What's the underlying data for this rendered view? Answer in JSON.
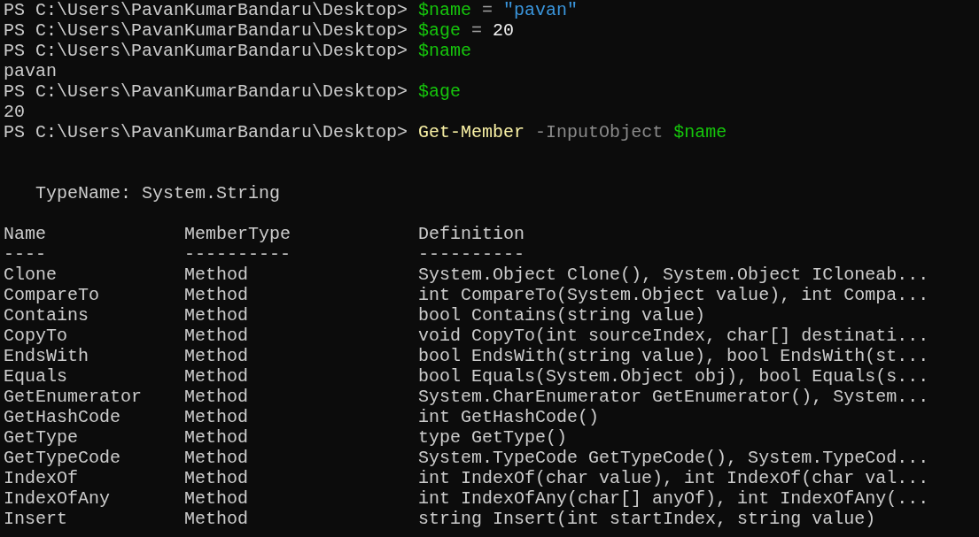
{
  "session": [
    {
      "kind": "command",
      "prompt": "PS C:\\Users\\PavanKumarBandaru\\Desktop>",
      "tokens": [
        {
          "text": "$name",
          "kind": "variable"
        },
        {
          "text": "=",
          "kind": "operator"
        },
        {
          "text": "\"pavan\"",
          "kind": "string"
        }
      ]
    },
    {
      "kind": "command",
      "prompt": "PS C:\\Users\\PavanKumarBandaru\\Desktop>",
      "tokens": [
        {
          "text": "$age",
          "kind": "variable"
        },
        {
          "text": "=",
          "kind": "operator"
        },
        {
          "text": "20",
          "kind": "number"
        }
      ]
    },
    {
      "kind": "command",
      "prompt": "PS C:\\Users\\PavanKumarBandaru\\Desktop>",
      "tokens": [
        {
          "text": "$name",
          "kind": "variable"
        }
      ]
    },
    {
      "kind": "output",
      "text": "pavan"
    },
    {
      "kind": "command",
      "prompt": "PS C:\\Users\\PavanKumarBandaru\\Desktop>",
      "tokens": [
        {
          "text": "$age",
          "kind": "variable"
        }
      ]
    },
    {
      "kind": "output",
      "text": "20"
    },
    {
      "kind": "command",
      "prompt": "PS C:\\Users\\PavanKumarBandaru\\Desktop>",
      "tokens": [
        {
          "text": "Get-Member",
          "kind": "cmdlet"
        },
        {
          "text": "-InputObject",
          "kind": "parameter"
        },
        {
          "text": "$name",
          "kind": "variable"
        }
      ]
    }
  ],
  "type_name": "TypeName: System.String",
  "table": {
    "columns": [
      {
        "label": "Name",
        "rule": "----"
      },
      {
        "label": "MemberType",
        "rule": "----------"
      },
      {
        "label": "Definition",
        "rule": "----------"
      }
    ],
    "rows": [
      [
        "Clone",
        "Method",
        "System.Object Clone(), System.Object ICloneab..."
      ],
      [
        "CompareTo",
        "Method",
        "int CompareTo(System.Object value), int Compa..."
      ],
      [
        "Contains",
        "Method",
        "bool Contains(string value)"
      ],
      [
        "CopyTo",
        "Method",
        "void CopyTo(int sourceIndex, char[] destinati..."
      ],
      [
        "EndsWith",
        "Method",
        "bool EndsWith(string value), bool EndsWith(st..."
      ],
      [
        "Equals",
        "Method",
        "bool Equals(System.Object obj), bool Equals(s..."
      ],
      [
        "GetEnumerator",
        "Method",
        "System.CharEnumerator GetEnumerator(), System..."
      ],
      [
        "GetHashCode",
        "Method",
        "int GetHashCode()"
      ],
      [
        "GetType",
        "Method",
        "type GetType()"
      ],
      [
        "GetTypeCode",
        "Method",
        "System.TypeCode GetTypeCode(), System.TypeCod..."
      ],
      [
        "IndexOf",
        "Method",
        "int IndexOf(char value), int IndexOf(char val..."
      ],
      [
        "IndexOfAny",
        "Method",
        "int IndexOfAny(char[] anyOf), int IndexOfAny(..."
      ],
      [
        "Insert",
        "Method",
        "string Insert(int startIndex, string value)"
      ]
    ]
  }
}
